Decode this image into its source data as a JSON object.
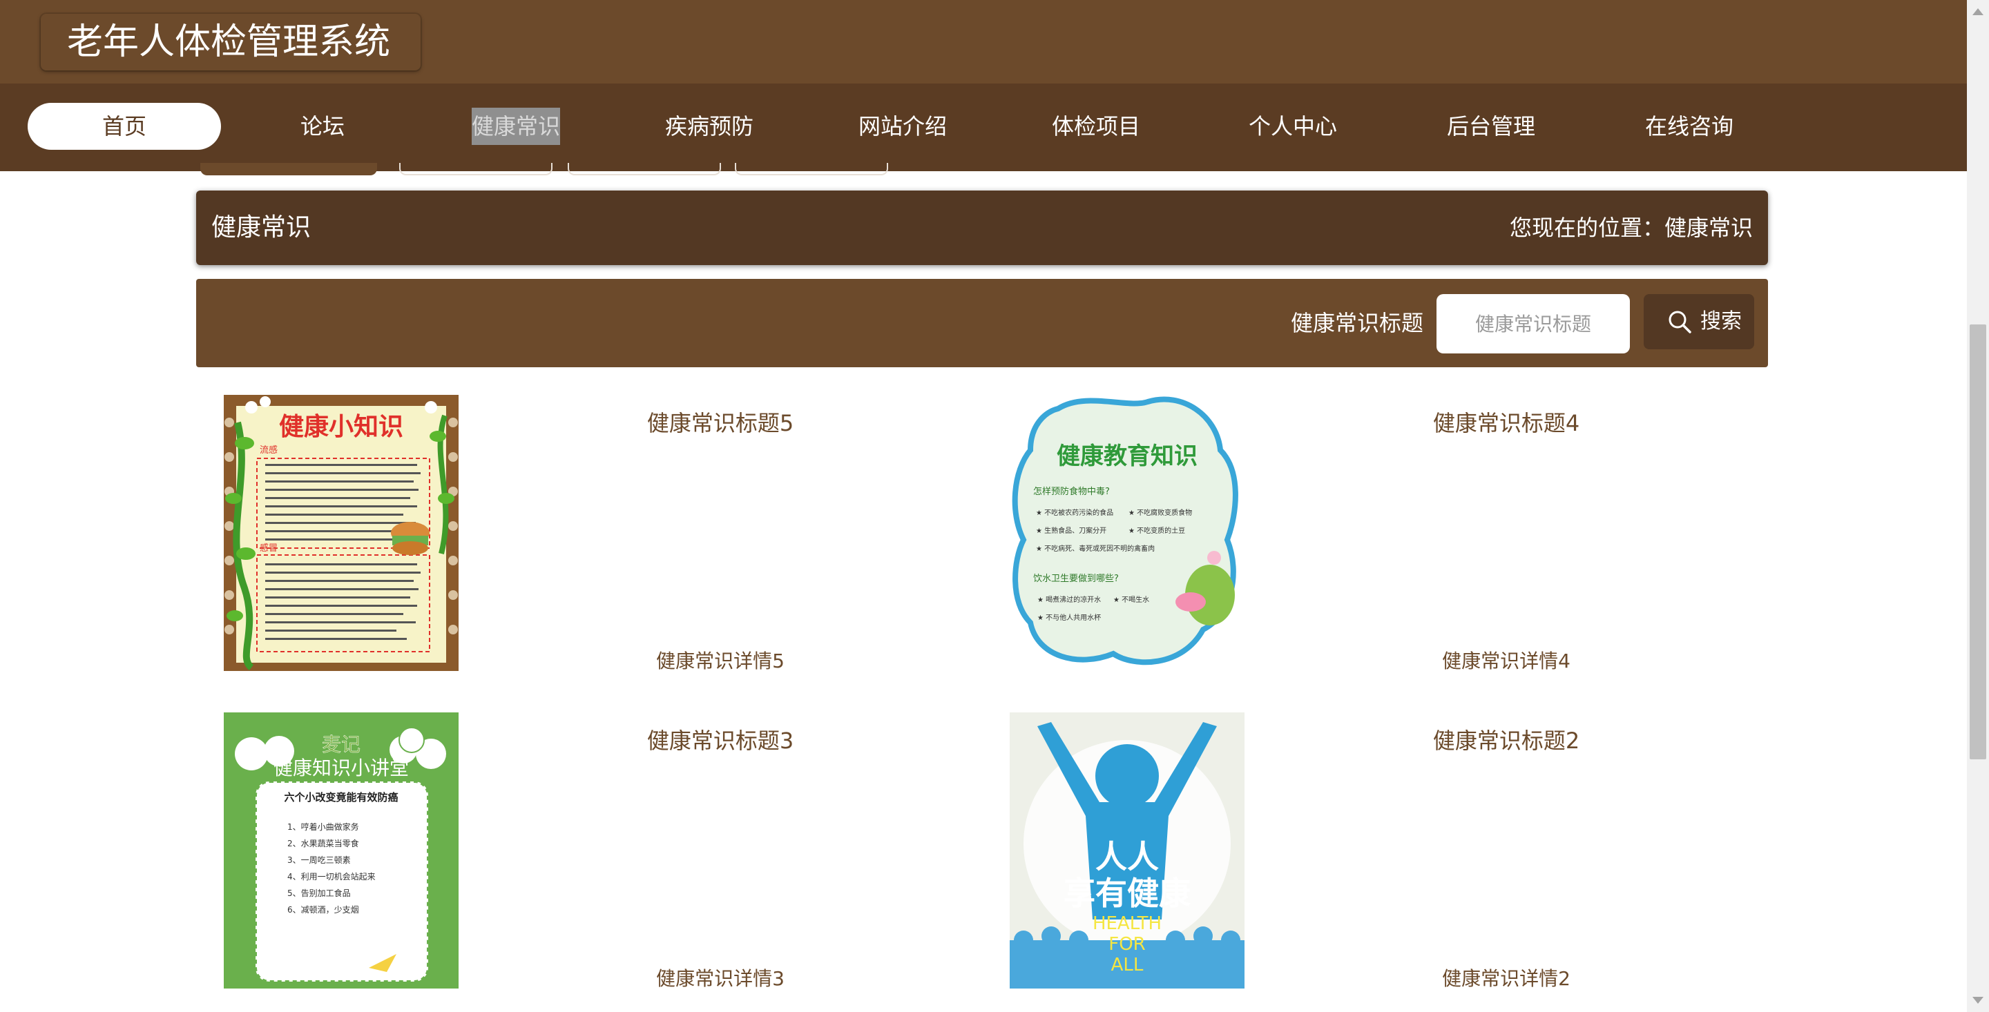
{
  "app": {
    "title": "老年人体检管理系统"
  },
  "nav": {
    "items": [
      {
        "label": "首页"
      },
      {
        "label": "论坛"
      },
      {
        "label": "健康常识"
      },
      {
        "label": "疾病预防"
      },
      {
        "label": "网站介绍"
      },
      {
        "label": "体检项目"
      },
      {
        "label": "个人中心"
      },
      {
        "label": "后台管理"
      },
      {
        "label": "在线咨询"
      }
    ]
  },
  "breadcrumb": {
    "title": "健康常识",
    "location": "您现在的位置：健康常识"
  },
  "search": {
    "label": "健康常识标题",
    "placeholder": "健康常识标题",
    "value": "",
    "button_label": "搜索"
  },
  "cards": [
    {
      "title": "健康常识标题5",
      "detail": "健康常识详情5",
      "image_text": [
        "健康小知识",
        "流感",
        "感冒"
      ]
    },
    {
      "title": "健康常识标题4",
      "detail": "健康常识详情4",
      "image_text": [
        "健康教育知识",
        "怎样预防食物中毒?",
        "不吃被农药污染的食品",
        "不吃腐败变质食物",
        "生熟食品、刀案分开",
        "不吃变质的土豆",
        "不吃病死、毒死或死因不明的禽畜肉",
        "饮水卫生要做到哪些?",
        "喝煮沸过的凉开水",
        "不喝生水",
        "不与他人共用水杯"
      ]
    },
    {
      "title": "健康常识标题3",
      "detail": "健康常识详情3",
      "image_text": [
        "麦记",
        "健康知识小讲堂",
        "六个小改变竟能有效防癌",
        "1、哼着小曲做家务",
        "2、水果蔬菜当零食",
        "3、一周吃三顿素",
        "4、利用一切机会站起来",
        "5、告别加工食品",
        "6、减顿酒，少支烟"
      ]
    },
    {
      "title": "健康常识标题2",
      "detail": "健康常识详情2",
      "image_text": [
        "人人",
        "享有健康",
        "HEALTH",
        "FOR",
        "ALL"
      ]
    }
  ],
  "colors": {
    "header": "#6c4a2b",
    "nav": "#5b3c23",
    "crumb": "#533823",
    "text": "#6b4a2b"
  }
}
